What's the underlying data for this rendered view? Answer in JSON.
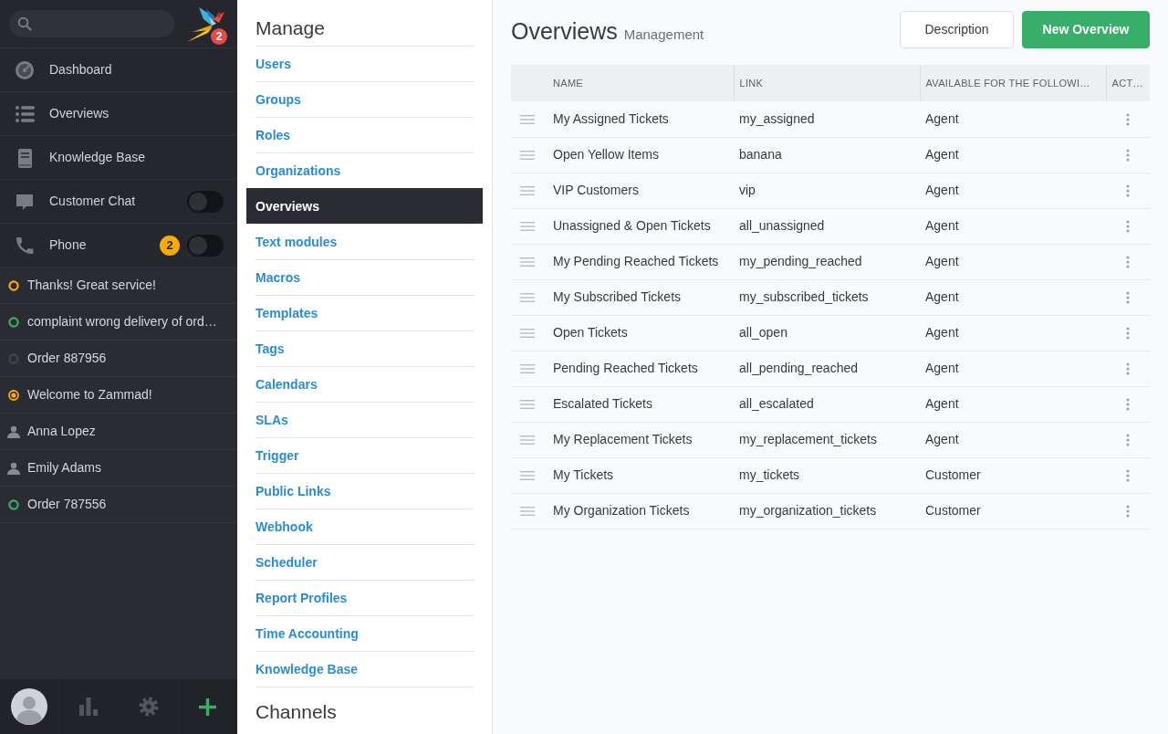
{
  "sidebar": {
    "logo_badge": "2",
    "nav": [
      {
        "label": "Dashboard",
        "kind": "link"
      },
      {
        "label": "Overviews",
        "kind": "link"
      },
      {
        "label": "Knowledge Base",
        "kind": "link"
      },
      {
        "label": "Customer Chat",
        "kind": "switch",
        "on": false
      },
      {
        "label": "Phone",
        "kind": "switch",
        "on": false,
        "badge": "2"
      }
    ],
    "tasks": [
      {
        "label": "Thanks! Great service!",
        "kind": "ticket",
        "color": "#faab00"
      },
      {
        "label": "complaint wrong delivery of ord…",
        "kind": "ticket",
        "color": "#38ae6a"
      },
      {
        "label": "Order 887956",
        "kind": "ticket",
        "color": "#44454c"
      },
      {
        "label": "Welcome to Zammad!",
        "kind": "ticket-dot",
        "color": "#faab00"
      },
      {
        "label": "Anna Lopez",
        "kind": "user"
      },
      {
        "label": "Emily Adams",
        "kind": "user"
      },
      {
        "label": "Order 787556",
        "kind": "ticket",
        "color": "#38ae6a"
      }
    ]
  },
  "admin_menu": {
    "sections": [
      {
        "title": "Manage",
        "items": [
          {
            "label": "Users",
            "selected": false
          },
          {
            "label": "Groups",
            "selected": false
          },
          {
            "label": "Roles",
            "selected": false
          },
          {
            "label": "Organizations",
            "selected": false
          },
          {
            "label": "Overviews",
            "selected": true
          },
          {
            "label": "Text modules",
            "selected": false
          },
          {
            "label": "Macros",
            "selected": false
          },
          {
            "label": "Templates",
            "selected": false
          },
          {
            "label": "Tags",
            "selected": false
          },
          {
            "label": "Calendars",
            "selected": false
          },
          {
            "label": "SLAs",
            "selected": false
          },
          {
            "label": "Trigger",
            "selected": false
          },
          {
            "label": "Public Links",
            "selected": false
          },
          {
            "label": "Webhook",
            "selected": false
          },
          {
            "label": "Scheduler",
            "selected": false
          },
          {
            "label": "Report Profiles",
            "selected": false
          },
          {
            "label": "Time Accounting",
            "selected": false
          },
          {
            "label": "Knowledge Base",
            "selected": false
          }
        ]
      },
      {
        "title": "Channels"
      }
    ]
  },
  "content": {
    "title": "Overviews",
    "subtitle": "Management",
    "buttons": [
      {
        "label": "Description",
        "kind": "secondary"
      },
      {
        "label": "New Overview",
        "kind": "primary"
      }
    ],
    "table": {
      "columns": [
        "NAME",
        "LINK",
        "AVAILABLE FOR THE FOLLOWI…",
        "ACT…"
      ],
      "rows": [
        {
          "name": "My Assigned Tickets",
          "link": "my_assigned",
          "available_for": "Agent"
        },
        {
          "name": "Open Yellow Items",
          "link": "banana",
          "available_for": "Agent"
        },
        {
          "name": "VIP Customers",
          "link": "vip",
          "available_for": "Agent"
        },
        {
          "name": "Unassigned & Open Tickets",
          "link": "all_unassigned",
          "available_for": "Agent"
        },
        {
          "name": "My Pending Reached Tickets",
          "link": "my_pending_reached",
          "available_for": "Agent"
        },
        {
          "name": "My Subscribed Tickets",
          "link": "my_subscribed_tickets",
          "available_for": "Agent"
        },
        {
          "name": "Open Tickets",
          "link": "all_open",
          "available_for": "Agent"
        },
        {
          "name": "Pending Reached Tickets",
          "link": "all_pending_reached",
          "available_for": "Agent"
        },
        {
          "name": "Escalated Tickets",
          "link": "all_escalated",
          "available_for": "Agent"
        },
        {
          "name": "My Replacement Tickets",
          "link": "my_replacement_tickets",
          "available_for": "Agent"
        },
        {
          "name": "My Tickets",
          "link": "my_tickets",
          "available_for": "Customer"
        },
        {
          "name": "My Organization Tickets",
          "link": "my_organization_tickets",
          "available_for": "Customer"
        }
      ]
    }
  }
}
